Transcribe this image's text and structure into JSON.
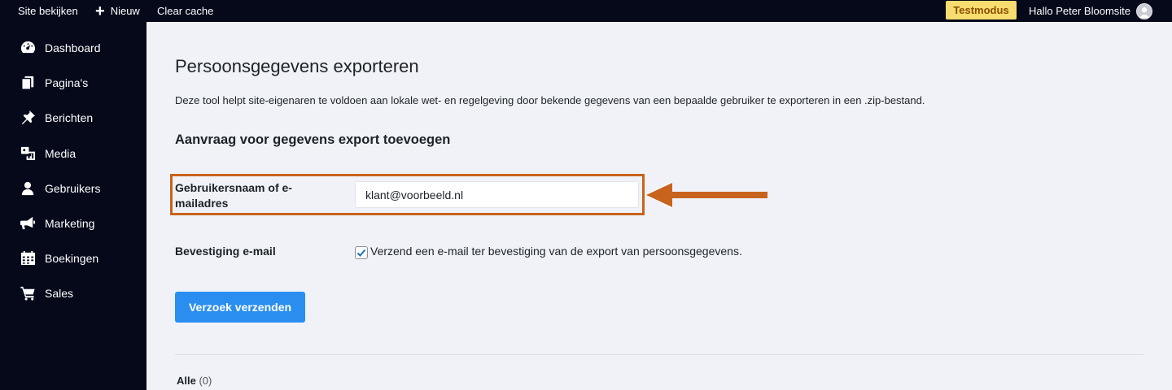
{
  "adminbar": {
    "view_site": "Site bekijken",
    "new_label": "Nieuw",
    "clear_cache": "Clear cache",
    "test_mode": "Testmodus",
    "greeting": "Hallo Peter Bloomsite"
  },
  "sidebar": {
    "items": [
      {
        "label": "Dashboard",
        "icon": "dashboard-icon"
      },
      {
        "label": "Pagina's",
        "icon": "pages-icon"
      },
      {
        "label": "Berichten",
        "icon": "pin-icon"
      },
      {
        "label": "Media",
        "icon": "media-icon"
      },
      {
        "label": "Gebruikers",
        "icon": "user-icon"
      },
      {
        "label": "Marketing",
        "icon": "megaphone-icon"
      },
      {
        "label": "Boekingen",
        "icon": "calendar-icon"
      },
      {
        "label": "Sales",
        "icon": "cart-icon"
      }
    ]
  },
  "main": {
    "title": "Persoonsgegevens exporteren",
    "description": "Deze tool helpt site-eigenaren te voldoen aan lokale wet- en regelgeving door bekende gegevens van een bepaalde gebruiker te exporteren in een .zip-bestand.",
    "section_title": "Aanvraag voor gegevens export toevoegen",
    "username_label": "Gebruikersnaam of e-mailadres",
    "username_value": "klant@voorbeeld.nl",
    "confirm_label": "Bevestiging e-mail",
    "confirm_checked": true,
    "confirm_text": "Verzend een e-mail ter bevestiging van de export van persoonsgegevens.",
    "submit_label": "Verzoek verzenden",
    "filter_all_label": "Alle",
    "filter_all_count": "(0)"
  },
  "colors": {
    "admin_bg": "#05091a",
    "accent": "#2a8ef0",
    "highlight": "#c8631d",
    "test_mode_bg": "#f7dc6f"
  }
}
